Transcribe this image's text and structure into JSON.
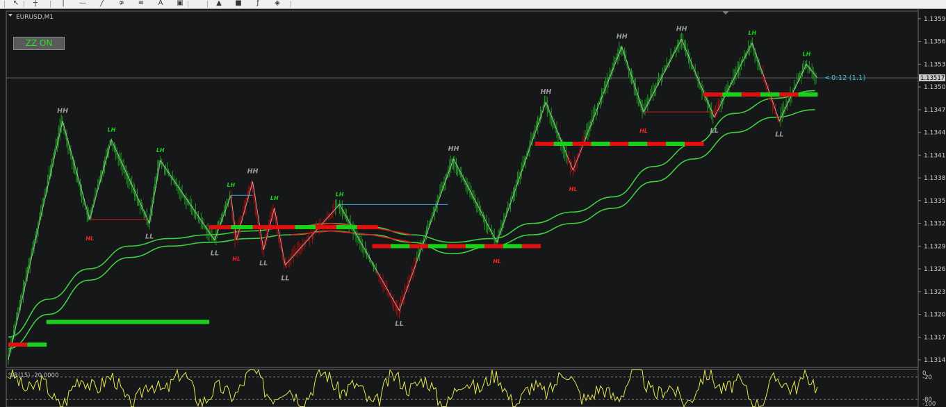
{
  "toolbar": {
    "items": [
      {
        "name": "cursor-icon",
        "glyph": "↖"
      },
      {
        "name": "crosshair-icon",
        "glyph": "┼"
      },
      {
        "name": "vertical-line-icon",
        "glyph": "│"
      },
      {
        "name": "horizontal-line-icon",
        "glyph": "—"
      },
      {
        "name": "trendline-icon",
        "glyph": "╱"
      },
      {
        "name": "equidistant-channel-icon",
        "glyph": "≉"
      },
      {
        "name": "fibonacci-icon",
        "glyph": "≡"
      },
      {
        "name": "text-icon",
        "glyph": "A"
      },
      {
        "name": "text-label-icon",
        "glyph": "▣"
      },
      {
        "name": "arrow-up-icon",
        "glyph": "▲"
      },
      {
        "name": "rectangle-icon",
        "glyph": "■"
      },
      {
        "name": "shapes-icon",
        "glyph": "ƒ"
      },
      {
        "name": "more-objects-icon",
        "glyph": "◈"
      }
    ]
  },
  "chart_label": "EURUSD,M1",
  "zz_button": "ZZ ON",
  "countdown": "0:12 (1.1)",
  "current_price": "1.13517",
  "oscillator_label": "%R(15) -20.0000",
  "colors": {
    "background": "#151719",
    "bull": "#1f9a1f",
    "bear": "#a01010",
    "level_green": "#19d119",
    "level_red": "#e01010",
    "label_gray": "#9a9a9a",
    "label_green": "#19d119",
    "label_red": "#ff2020",
    "oscillator": "#e8e850",
    "zigzag": "#cfcfcf",
    "countdown": "#41c8e8"
  },
  "chart_data": {
    "type": "line",
    "symbol": "EURUSD",
    "timeframe": "M1",
    "ylim": [
      1.13135,
      1.13605
    ],
    "y_ticks": [
      "1.13595",
      "1.13565",
      "1.13535",
      "1.13505",
      "1.13475",
      "1.13445",
      "1.13415",
      "1.13385",
      "1.13355",
      "1.13325",
      "1.13295",
      "1.13265",
      "1.13235",
      "1.13205",
      "1.13175",
      "1.13145"
    ],
    "zigzag": [
      {
        "bar": 0,
        "price": 1.13145
      },
      {
        "bar": 10,
        "price": 1.1346,
        "label": "HH",
        "kind": "hh"
      },
      {
        "bar": 15,
        "price": 1.1333,
        "label": "HL",
        "kind": "hl"
      },
      {
        "bar": 19,
        "price": 1.13435,
        "label": "LH",
        "kind": "lh"
      },
      {
        "bar": 26,
        "price": 1.13325,
        "label": "LL",
        "kind": "ll"
      },
      {
        "bar": 28,
        "price": 1.13408,
        "label": "LH",
        "kind": "lh"
      },
      {
        "bar": 38,
        "price": 1.13303,
        "label": "LL",
        "kind": "ll"
      },
      {
        "bar": 41,
        "price": 1.13362,
        "label": "LH",
        "kind": "lh"
      },
      {
        "bar": 42,
        "price": 1.13303,
        "label": "HL",
        "kind": "hl"
      },
      {
        "bar": 45,
        "price": 1.1338,
        "label": "HH",
        "kind": "hh"
      },
      {
        "bar": 47,
        "price": 1.1329,
        "label": "LL",
        "kind": "ll"
      },
      {
        "bar": 49,
        "price": 1.13345,
        "label": "LH",
        "kind": "lh"
      },
      {
        "bar": 51,
        "price": 1.1327,
        "label": "LL",
        "kind": "ll"
      },
      {
        "bar": 61,
        "price": 1.1335,
        "label": "LH",
        "kind": "lh"
      },
      {
        "bar": 72,
        "price": 1.1321,
        "label": "LL",
        "kind": "ll"
      },
      {
        "bar": 82,
        "price": 1.1341,
        "label": "HH",
        "kind": "hh"
      },
      {
        "bar": 90,
        "price": 1.133,
        "label": "HL",
        "kind": "hl"
      },
      {
        "bar": 99,
        "price": 1.13485,
        "label": "HH",
        "kind": "hh"
      },
      {
        "bar": 104,
        "price": 1.13395,
        "label": "HL",
        "kind": "hl"
      },
      {
        "bar": 113,
        "price": 1.13558,
        "label": "HH",
        "kind": "hh"
      },
      {
        "bar": 117,
        "price": 1.13472,
        "label": "HL",
        "kind": "hl"
      },
      {
        "bar": 124,
        "price": 1.13568,
        "label": "HH",
        "kind": "hh"
      },
      {
        "bar": 130,
        "price": 1.13465,
        "label": "LL",
        "kind": "ll"
      },
      {
        "bar": 137,
        "price": 1.13563,
        "label": "LH",
        "kind": "lh"
      },
      {
        "bar": 142,
        "price": 1.1346,
        "label": "LL",
        "kind": "ll"
      },
      {
        "bar": 147,
        "price": 1.13535,
        "label": "LH",
        "kind": "lh"
      },
      {
        "bar": 149,
        "price": 1.13517
      }
    ],
    "levels": [
      {
        "bar_from": 0,
        "bar_to": 7,
        "price": 1.13165,
        "color": "mixed"
      },
      {
        "bar_from": 7,
        "bar_to": 37,
        "price": 1.13195,
        "color": "green"
      },
      {
        "bar_from": 37,
        "bar_to": 49,
        "price": 1.1332,
        "color": "mixed"
      },
      {
        "bar_from": 49,
        "bar_to": 68,
        "price": 1.1332,
        "color": "mixed"
      },
      {
        "bar_from": 67,
        "bar_to": 98,
        "price": 1.13295,
        "color": "mixed"
      },
      {
        "bar_from": 97,
        "bar_to": 128,
        "price": 1.1343,
        "color": "mixed"
      },
      {
        "bar_from": 128,
        "bar_to": 149,
        "price": 1.13495,
        "color": "mixed"
      }
    ],
    "ma_upper": [
      1.13175,
      1.13225,
      1.13265,
      1.13295,
      1.13305,
      1.1331,
      1.13315,
      1.1332,
      1.13325,
      1.1332,
      1.1331,
      1.133,
      1.13305,
      1.13325,
      1.1334,
      1.1336,
      1.134,
      1.1343,
      1.1347,
      1.1349,
      1.135
    ],
    "ma_lower": [
      1.1316,
      1.13205,
      1.1325,
      1.1328,
      1.13295,
      1.133,
      1.13305,
      1.1331,
      1.13315,
      1.1331,
      1.133,
      1.13285,
      1.13295,
      1.1331,
      1.13325,
      1.13345,
      1.1338,
      1.1341,
      1.13445,
      1.13465,
      1.13475
    ],
    "ma_red_segments": [
      [
        7,
        10
      ]
    ]
  },
  "oscillator_data": {
    "type": "line",
    "ylim": [
      -100,
      0
    ],
    "levels": [
      "0",
      "-20",
      "-80",
      "-100"
    ]
  }
}
